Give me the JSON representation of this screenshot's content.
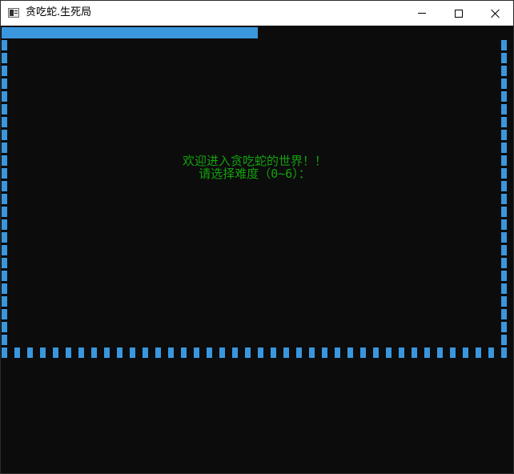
{
  "window": {
    "title": "贪吃蛇.生死局",
    "icon": "console-app-icon",
    "controls": [
      "minimize",
      "maximize",
      "close"
    ]
  },
  "console": {
    "background": "#0c0c0c",
    "wall_color": "#3a96dd",
    "text_color": "#13a10e",
    "welcome_line": "欢迎进入贪吃蛇的世界！！",
    "prompt_line": "请选择难度（0~6）："
  }
}
